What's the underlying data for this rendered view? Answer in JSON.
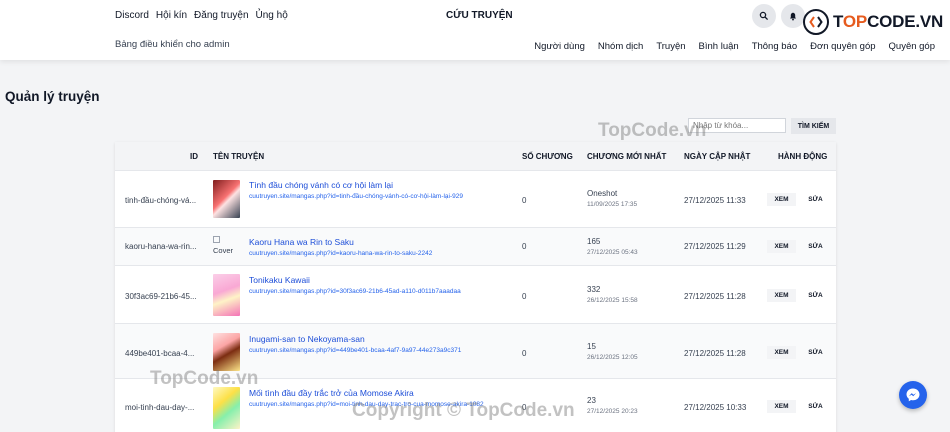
{
  "header": {
    "nav": [
      "Discord",
      "Hội kín",
      "Đăng truyện",
      "Ủng hộ"
    ],
    "brand": "CỨU TRUYỆN",
    "subtitle": "Bảng điều khiển cho admin",
    "admin_nav": [
      "Người dùng",
      "Nhóm dịch",
      "Truyện",
      "Bình luận",
      "Thông báo",
      "Đơn quyên góp",
      "Quyên góp"
    ]
  },
  "logo": {
    "prefix": "T",
    "text_accent": "OP",
    "text_rest": "CODE.VN"
  },
  "page": {
    "title": "Quản lý truyện",
    "search_placeholder": "Nhập từ khóa...",
    "search_button": "TÌM KIẾM"
  },
  "table": {
    "headers": [
      "ID",
      "TÊN TRUYỆN",
      "SỐ CHƯƠNG",
      "CHƯƠNG MỚI NHẤT",
      "NGÀY CẬP NHẬT",
      "HÀNH ĐỘNG"
    ],
    "view_label": "XEM",
    "edit_label": "SỬA",
    "rows": [
      {
        "id": "tinh-đầu-chóng-vá...",
        "title": "Tình đầu chóng vánh có cơ hội làm lại",
        "url": "cuutruyen.site/mangas.php?id=tinh-đầu-chóng-vánh-có-cơ-hội-làm-lại-929",
        "chapters": "0",
        "latest": "Oneshot",
        "latest_date": "11/09/2025 17:35",
        "updated": "27/12/2025 11:33"
      },
      {
        "id": "kaoru-hana-wa-rin...",
        "cover_alt": "Cover",
        "title": "Kaoru Hana wa Rin to Saku",
        "url": "cuutruyen.site/mangas.php?id=kaoru-hana-wa-rin-to-saku-2242",
        "chapters": "0",
        "latest": "165",
        "latest_date": "27/12/2025 05:43",
        "updated": "27/12/2025 11:29"
      },
      {
        "id": "30f3ac69-21b6-45...",
        "title": "Tonikaku Kawaii",
        "url": "cuutruyen.site/mangas.php?id=30f3ac69-21b6-45ad-a110-d011b7aaadaa",
        "chapters": "0",
        "latest": "332",
        "latest_date": "26/12/2025 15:58",
        "updated": "27/12/2025 11:28"
      },
      {
        "id": "449be401-bcaa-4...",
        "title": "Inugami-san to Nekoyama-san",
        "url": "cuutruyen.site/mangas.php?id=449be401-bcaa-4af7-9a97-44e273a9c371",
        "chapters": "0",
        "latest": "15",
        "latest_date": "26/12/2025 12:05",
        "updated": "27/12/2025 11:28"
      },
      {
        "id": "moi-tinh-dau-day-...",
        "title": "Mối tình đầu đầy trắc trở của Momose Akira",
        "url": "cuutruyen.site/mangas.php?id=moi-tinh-dau-day-trac-tro-cua-momose-akira-1082",
        "chapters": "0",
        "latest": "23",
        "latest_date": "27/12/2025 20:23",
        "updated": "27/12/2025 10:33"
      }
    ]
  },
  "watermarks": {
    "mid": "TopCode.vn",
    "bottom_left": "TopCode.vn",
    "copyright": "Copyright © TopCode.vn"
  },
  "colors": {
    "link": "#1d4ed8",
    "accent": "#e65b1e",
    "messenger": "#2563eb"
  }
}
